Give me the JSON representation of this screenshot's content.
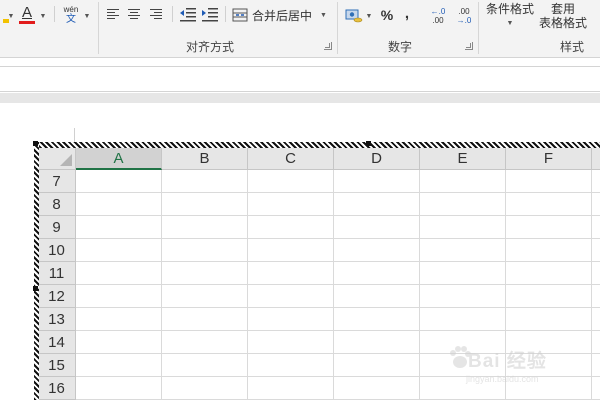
{
  "ribbon": {
    "font_color_icon": "A",
    "phonetic_icon_top": "wén",
    "phonetic_icon_bottom": "文",
    "merge_center_label": "合并后居中",
    "alignment_group_label": "对齐方式",
    "number_group_label": "数字",
    "percent_label": "%",
    "comma_label": ",",
    "increase_decimal_top": "←.0",
    "increase_decimal_bottom": ".00",
    "decrease_decimal_top": ".00",
    "decrease_decimal_bottom": "→.0",
    "conditional_format_label": "条件格式",
    "table_format_line1": "套用",
    "table_format_line2": "表格格式",
    "styles_group_label": "样式",
    "accent_red": "#e11b1b",
    "accent_green": "#217346"
  },
  "sheet": {
    "columns": [
      "A",
      "B",
      "C",
      "D",
      "E",
      "F"
    ],
    "selected_column": "A",
    "rows": [
      "7",
      "8",
      "9",
      "10",
      "11",
      "12",
      "13",
      "14",
      "15",
      "16"
    ]
  },
  "watermark": {
    "text": "Bai 经验",
    "sub": "jingyan.baidu.com"
  }
}
